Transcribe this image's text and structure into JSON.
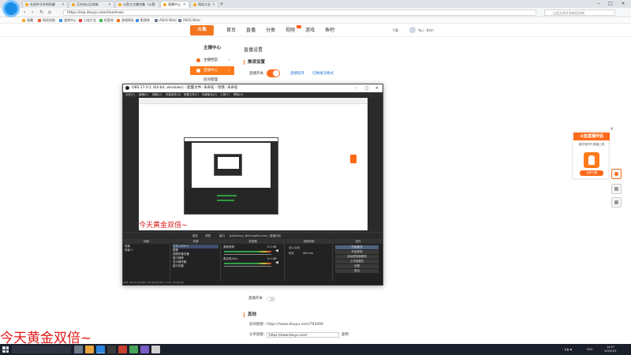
{
  "browser": {
    "tabs": [
      {
        "label": "在虎扑牙外的防御"
      },
      {
        "label": "正在听以后的新"
      },
      {
        "label": "斗鱼大主播合集（斗鱼"
      },
      {
        "label": "直播中心"
      },
      {
        "label": "网站大全"
      }
    ],
    "url": "https://mp.douyu.com/live/main",
    "search_placeholder": "山西太原开发新区的热",
    "bookmarks": [
      {
        "label": "收藏"
      },
      {
        "label": "网站导航"
      },
      {
        "label": "游戏中心"
      },
      {
        "label": "小说大全"
      },
      {
        "label": "检索库"
      },
      {
        "label": "游戏网址"
      },
      {
        "label": "影视库"
      },
      {
        "label": "ASUS Wsal"
      },
      {
        "label": "ASUS Wsal"
      }
    ]
  },
  "site": {
    "logo": "斗鱼",
    "nav": [
      {
        "label": "首页"
      },
      {
        "label": "直播"
      },
      {
        "label": "分类"
      },
      {
        "label": "视频"
      },
      {
        "label": "游戏"
      },
      {
        "label": "鱼吧"
      }
    ],
    "header_right": {
      "download": "下载",
      "username": "You - Beih"
    },
    "sidebar": {
      "title": "主播中心",
      "items": [
        {
          "label": "主播档案"
        },
        {
          "label": "直播中心"
        },
        {
          "label": "房间管理"
        }
      ]
    },
    "page_title": "直播设置",
    "section_stream": "推流设置",
    "toggle_label": "直播开关",
    "links": [
      "直播程序",
      "切换推流格式"
    ],
    "bottom_toggle_label": "直播开关",
    "section_other": "其他",
    "room_link_label": "房间链接：",
    "room_link_value": "https://www.douyu.com/793400",
    "share_label": "分享链接：",
    "share_value": "https://www.douyu.com/",
    "share_button": "复制"
  },
  "promo": {
    "title": "斗鱼直播伴侣",
    "subtitle": "超好用的PC直播工具",
    "button": "立即下载"
  },
  "obs": {
    "title": "OBS 27.0.1 (64-bit, windows) - 配置文件: 未命名 - 场景: 未命名",
    "menu": [
      "文件(F)",
      "编辑(E)",
      "视图(V)",
      "停靠部件(D)",
      "配置文件(P)",
      "场景集合(S)",
      "工具(T)",
      "帮助(H)"
    ],
    "preview_overlay": "今天黄金双倍~",
    "sub_toolbar": [
      "属性",
      "滤镜",
      "窗口",
      "[pGdoiuyu_Beih(sqlite).exe]",
      "直播伴侣"
    ],
    "docks": {
      "scenes": {
        "title": "场景",
        "items": [
          "场景",
          "场景 2"
        ]
      },
      "sources": {
        "title": "来源",
        "items": [
          "文本 (GDI+)",
          "图像",
          "视频采集设备",
          "窗口捕获",
          "显示器采集",
          "窗口采集"
        ]
      },
      "mixer": {
        "title": "混音器",
        "items": [
          {
            "name": "桌面音频",
            "db": "0.0 dB"
          },
          {
            "name": "麦克风/Aux",
            "db": "0.0 dB"
          }
        ]
      },
      "transitions": {
        "title": "场景转换",
        "type": "淡入淡出",
        "duration_label": "时长",
        "duration": "300 ms"
      },
      "controls": {
        "title": "控件",
        "buttons": [
          "开始推流",
          "开始录制",
          "启动虚拟摄像机",
          "工作室模式",
          "设置",
          "退出"
        ]
      }
    },
    "status": "LIVE: 00:00:00   REC: 00:00:00   CPU: 2.5%, 30.00 fps"
  },
  "overlay_text": "今天黄金双倍~",
  "taskbar": {
    "tray_text": "ENG",
    "time": "14:57",
    "date": "2022/3/1"
  }
}
